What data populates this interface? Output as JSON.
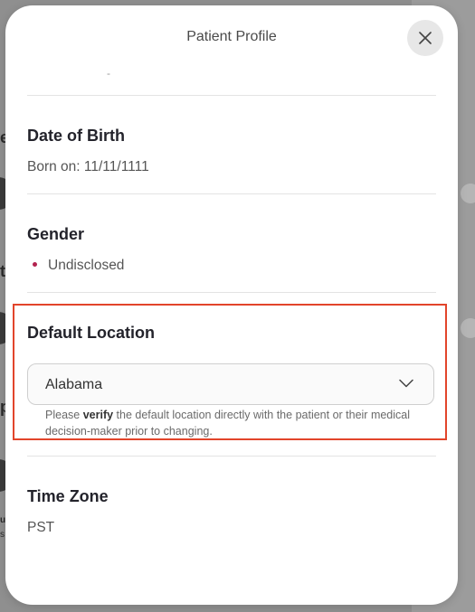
{
  "background": {
    "fragments": [
      "e",
      "t",
      "p",
      "ur",
      "s"
    ]
  },
  "modal": {
    "title": "Patient Profile",
    "close_icon": "close-icon"
  },
  "sections": {
    "dob": {
      "title": "Date of Birth",
      "value": "Born on: 11/11/1111"
    },
    "gender": {
      "title": "Gender",
      "value": "Undisclosed"
    },
    "default_location": {
      "title": "Default Location",
      "selected": "Alabama",
      "chevron_icon": "chevron-down-icon",
      "help_prefix": "Please ",
      "help_bold": "verify",
      "help_suffix": " the default location directly with the patient or their medical decision-maker prior to changing."
    },
    "time_zone": {
      "title": "Time Zone",
      "value": "PST"
    }
  },
  "colors": {
    "highlight": "#e2452b",
    "bullet": "#b3234f"
  }
}
